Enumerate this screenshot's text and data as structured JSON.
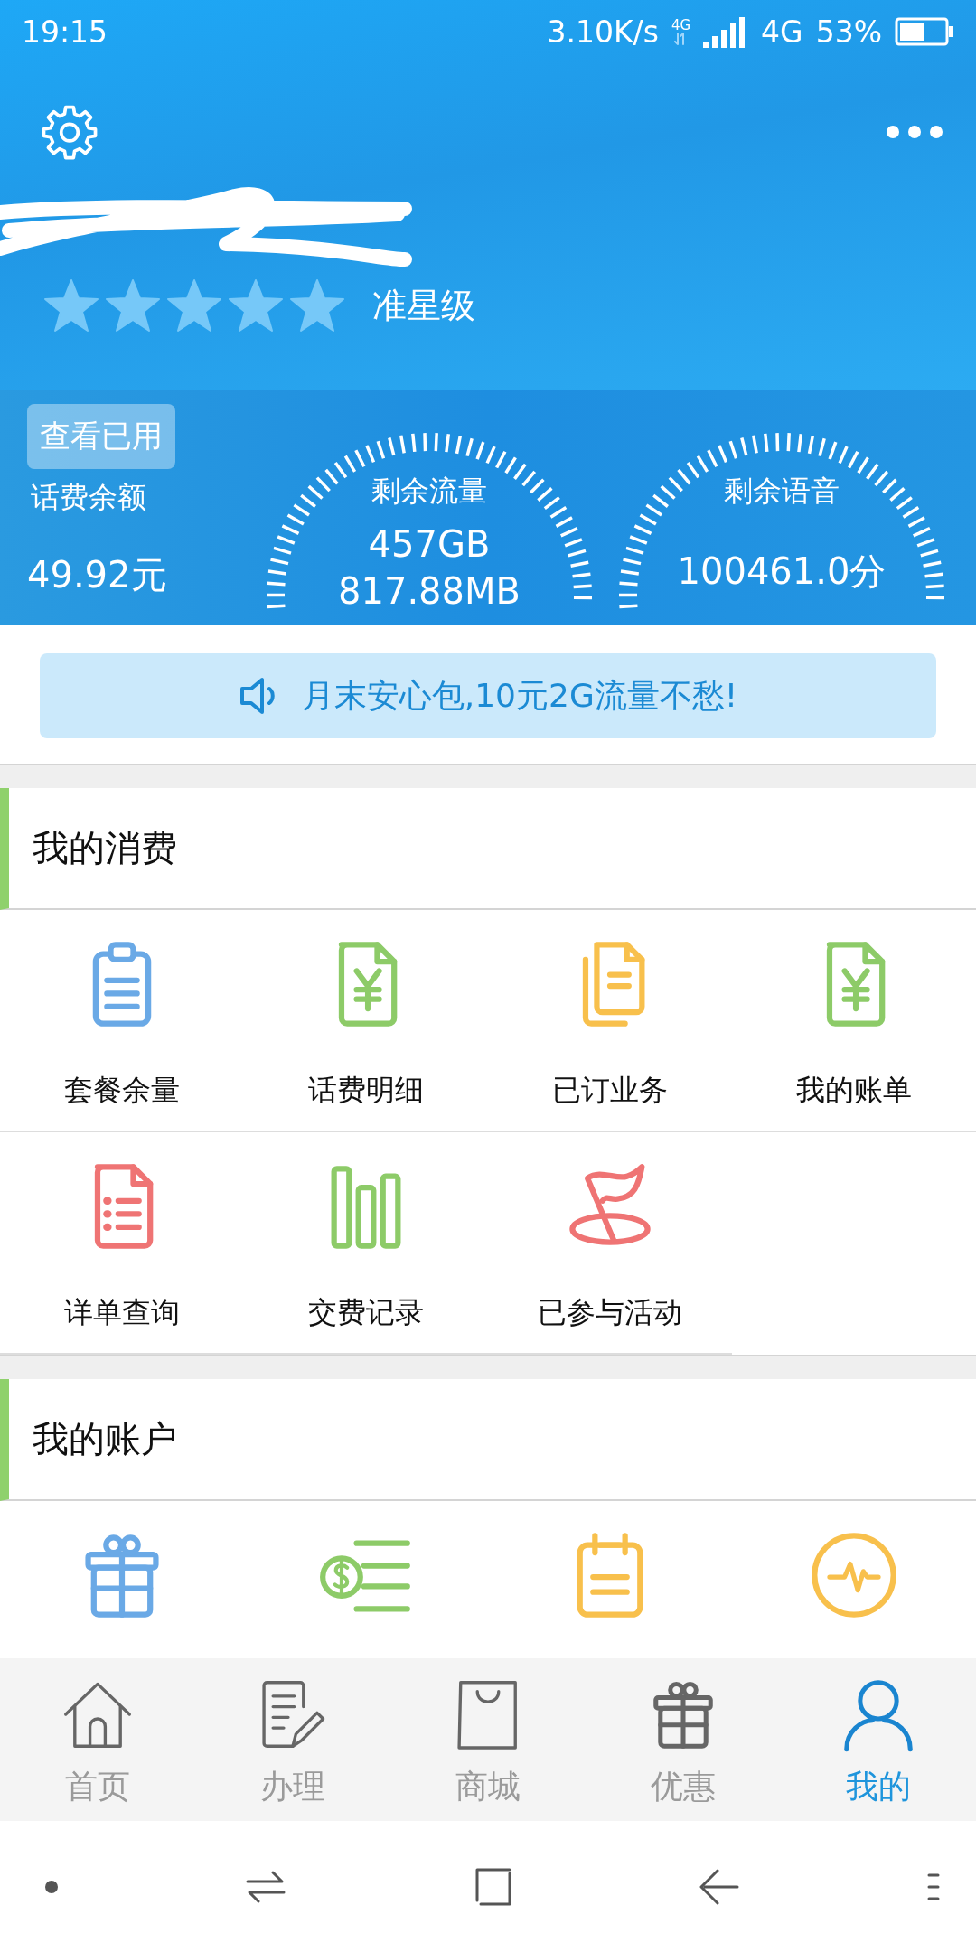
{
  "status_bar": {
    "time": "19:15",
    "speed": "3.10K/s",
    "network_small": "4G",
    "network": "4G",
    "battery": "53%"
  },
  "header": {
    "stars": 5,
    "level_label": "准星级"
  },
  "balance": {
    "button": "查看已用",
    "label": "话费余额",
    "value": "49.92元"
  },
  "gauges": [
    {
      "title": "剩余流量",
      "lines": [
        "457GB",
        "817.88MB"
      ]
    },
    {
      "title": "剩余语音",
      "lines": [
        "100461.0分"
      ]
    }
  ],
  "banner": {
    "text": "月末安心包,10元2G流量不愁!"
  },
  "sections": [
    {
      "title": "我的消费",
      "items": [
        {
          "kind": "clipboard",
          "label": "套餐余量"
        },
        {
          "kind": "bill",
          "label": "话费明细"
        },
        {
          "kind": "documents",
          "label": "已订业务"
        },
        {
          "kind": "bill",
          "label": "我的账单"
        },
        {
          "kind": "list",
          "label": "详单查询"
        },
        {
          "kind": "bars",
          "label": "交费记录"
        },
        {
          "kind": "flag",
          "label": "已参与活动"
        }
      ]
    },
    {
      "title": "我的账户",
      "items": [
        {
          "kind": "gift"
        },
        {
          "kind": "money"
        },
        {
          "kind": "calendar"
        },
        {
          "kind": "pulse"
        }
      ]
    }
  ],
  "tabs": [
    {
      "kind": "home",
      "label": "首页",
      "selected": false
    },
    {
      "kind": "edit",
      "label": "办理",
      "selected": false
    },
    {
      "kind": "bag",
      "label": "商城",
      "selected": false
    },
    {
      "kind": "gift",
      "label": "优惠",
      "selected": false
    },
    {
      "kind": "user",
      "label": "我的",
      "selected": true
    }
  ]
}
